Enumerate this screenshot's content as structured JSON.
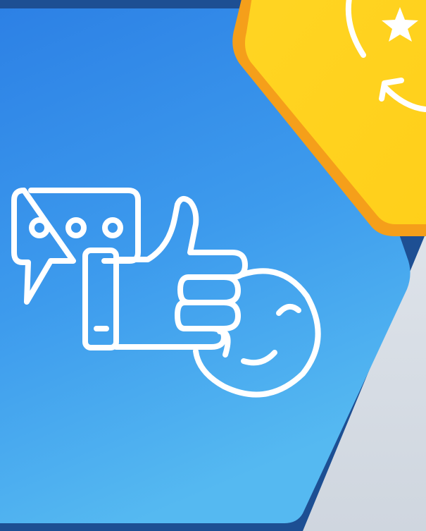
{
  "scene": {
    "icons": [
      "chat-bubble-icon",
      "thumbs-up-icon",
      "smiley-icon",
      "star-refresh-icon"
    ],
    "colors": {
      "background": "#d6dbe3",
      "blue_gradient_top": "#2f85e6",
      "blue_gradient_bottom": "#4fb3ef",
      "navy_border": "#1d4f93",
      "yellow_tile": "#ffd21f",
      "orange_border": "#f6a019",
      "line_art": "#ffffff"
    }
  }
}
